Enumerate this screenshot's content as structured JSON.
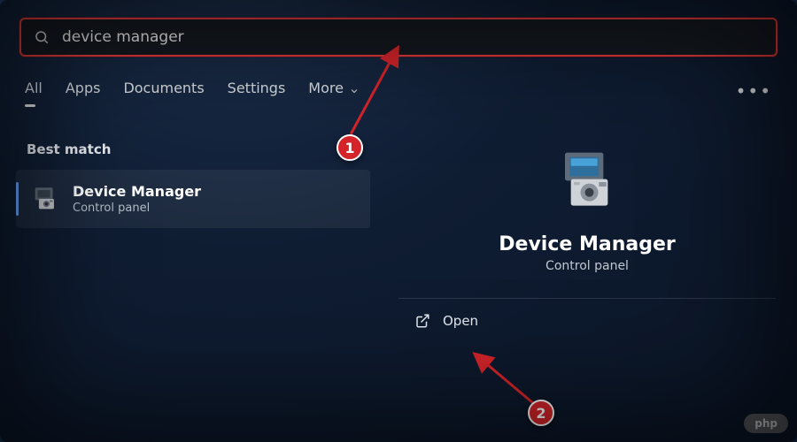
{
  "search": {
    "value": "device manager"
  },
  "tabs": {
    "items": [
      "All",
      "Apps",
      "Documents",
      "Settings",
      "More"
    ],
    "active_index": 0
  },
  "section_label": "Best match",
  "result": {
    "title": "Device Manager",
    "subtitle": "Control panel"
  },
  "details": {
    "title": "Device Manager",
    "subtitle": "Control panel",
    "open_label": "Open"
  },
  "annotations": {
    "callout1": "1",
    "callout2": "2"
  },
  "watermark": "php"
}
